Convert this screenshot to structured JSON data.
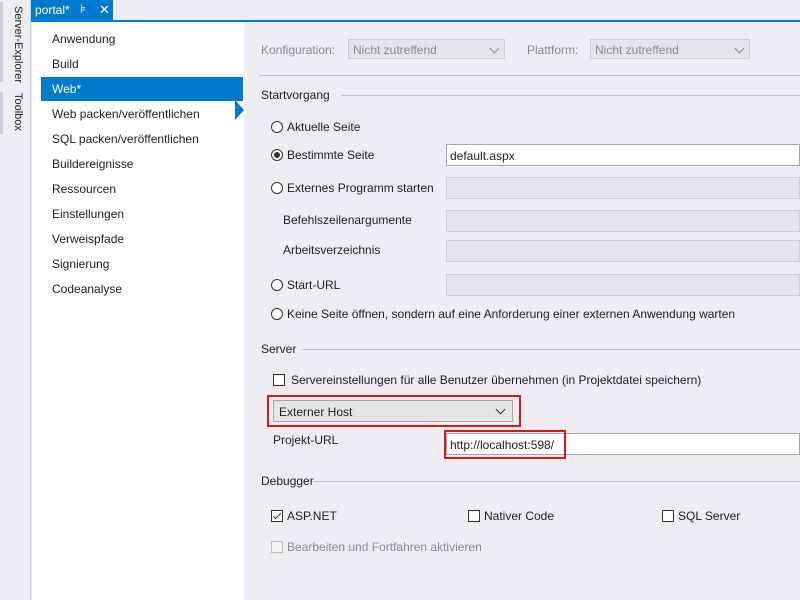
{
  "sidebar_tools": {
    "server_explorer": "Server-Explorer",
    "toolbox": "Toolbox"
  },
  "document_tab": {
    "title": "portal*",
    "pin_icon": "pin-icon",
    "close_icon": "close-icon"
  },
  "nav": {
    "items": [
      {
        "label": "Anwendung"
      },
      {
        "label": "Build"
      },
      {
        "label": "Web*"
      },
      {
        "label": "Web packen/veröffentlichen"
      },
      {
        "label": "SQL packen/veröffentlichen"
      },
      {
        "label": "Buildereignisse"
      },
      {
        "label": "Ressourcen"
      },
      {
        "label": "Einstellungen"
      },
      {
        "label": "Verweispfade"
      },
      {
        "label": "Signierung"
      },
      {
        "label": "Codeanalyse"
      }
    ],
    "selected_index": 2
  },
  "config": {
    "konfiguration_label": "Konfiguration:",
    "konfiguration_value": "Nicht zutreffend",
    "plattform_label": "Plattform:",
    "plattform_value": "Nicht zutreffend"
  },
  "startvorgang": {
    "title": "Startvorgang",
    "aktuelle_seite": "Aktuelle Seite",
    "bestimmte_seite": "Bestimmte Seite",
    "bestimmte_seite_value": "default.aspx",
    "externes_programm": "Externes Programm starten",
    "befehlszeilenargumente": "Befehlszeilenargumente",
    "arbeitsverzeichnis": "Arbeitsverzeichnis",
    "start_url": "Start-URL",
    "keine_seite": "Keine Seite öffnen, sondern auf eine Anforderung einer externen Anwendung warten",
    "selected": "bestimmte_seite"
  },
  "server": {
    "title": "Server",
    "checkbox_label": "Servereinstellungen für alle Benutzer übernehmen (in Projektdatei speichern)",
    "checkbox_checked": false,
    "host_value": "Externer Host",
    "projekt_url_label": "Projekt-URL",
    "projekt_url_value": "http://localhost:598/"
  },
  "debugger": {
    "title": "Debugger",
    "aspnet": "ASP.NET",
    "aspnet_checked": true,
    "nativer_code": "Nativer Code",
    "nativer_code_checked": false,
    "sql_server": "SQL Server",
    "sql_server_checked": false,
    "edit_continue": "Bearbeiten und Fortfahren aktivieren",
    "edit_continue_enabled": false
  },
  "colors": {
    "accent": "#007acc",
    "highlight": "#d7191c",
    "background": "#eeeef2"
  }
}
